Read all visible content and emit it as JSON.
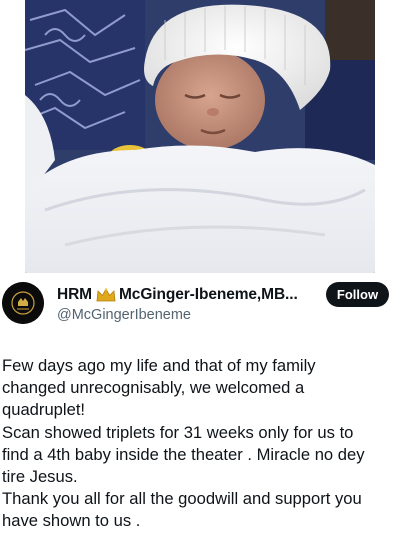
{
  "tweet": {
    "author": {
      "display_name_prefix": "HRM",
      "display_name": "McGinger-Ibeneme,MB...",
      "handle": "@McGingerIbeneme",
      "name_emoji": "crown-icon"
    },
    "follow_label": "Follow",
    "text": "Few days ago my life and that of my family\nchanged unrecognisably, we welcomed a\nquadruplet!\nScan showed triplets for 31 weeks only for us to\nfind a 4th baby inside the theater . Miracle no dey\ntire Jesus.\nThank you all for all the goodwill and support you\nhave shown to us ."
  },
  "colors": {
    "follow_button_bg": "#0f1419",
    "handle": "#536471"
  }
}
